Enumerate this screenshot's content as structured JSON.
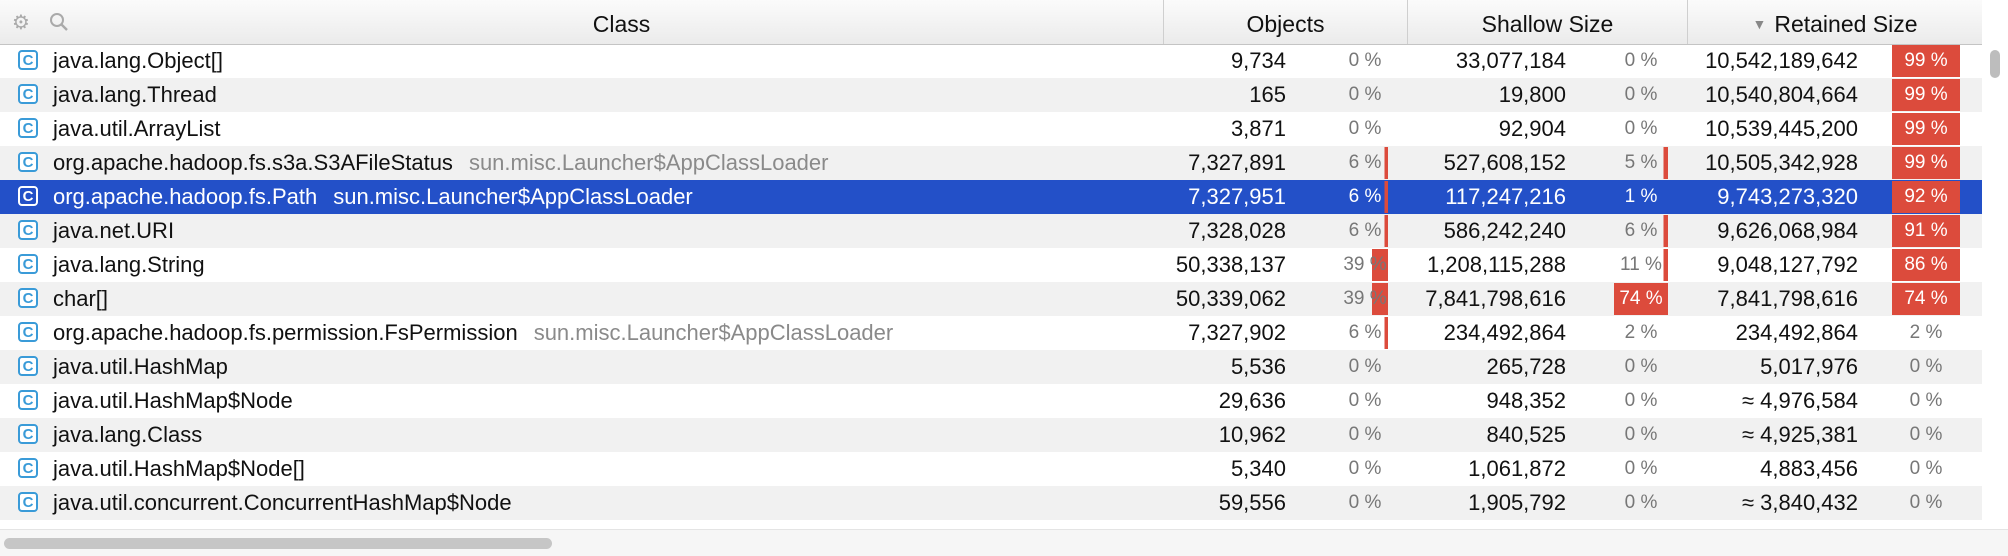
{
  "header": {
    "class": "Class",
    "objects": "Objects",
    "shallow": "Shallow Size",
    "retained": "Retained Size",
    "settings_icon": "gear-icon",
    "search_icon": "search-icon"
  },
  "rows": [
    {
      "name": "java.lang.Object[]",
      "loader": "",
      "objects": "9,734",
      "objects_pct": "0 %",
      "shallow": "33,077,184",
      "shallow_pct": "0 %",
      "retained": "10,542,189,642",
      "retained_pct": "99 %"
    },
    {
      "name": "java.lang.Thread",
      "loader": "",
      "objects": "165",
      "objects_pct": "0 %",
      "shallow": "19,800",
      "shallow_pct": "0 %",
      "retained": "10,540,804,664",
      "retained_pct": "99 %"
    },
    {
      "name": "java.util.ArrayList",
      "loader": "",
      "objects": "3,871",
      "objects_pct": "0 %",
      "shallow": "92,904",
      "shallow_pct": "0 %",
      "retained": "10,539,445,200",
      "retained_pct": "99 %"
    },
    {
      "name": "org.apache.hadoop.fs.s3a.S3AFileStatus",
      "loader": "sun.misc.Launcher$AppClassLoader",
      "objects": "7,327,891",
      "objects_pct": "6 %",
      "shallow": "527,608,152",
      "shallow_pct": "5 %",
      "retained": "10,505,342,928",
      "retained_pct": "99 %"
    },
    {
      "name": "org.apache.hadoop.fs.Path",
      "loader": "sun.misc.Launcher$AppClassLoader",
      "objects": "7,327,951",
      "objects_pct": "6 %",
      "shallow": "117,247,216",
      "shallow_pct": "1 %",
      "retained": "9,743,273,320",
      "retained_pct": "92 %"
    },
    {
      "name": "java.net.URI",
      "loader": "",
      "objects": "7,328,028",
      "objects_pct": "6 %",
      "shallow": "586,242,240",
      "shallow_pct": "6 %",
      "retained": "9,626,068,984",
      "retained_pct": "91 %"
    },
    {
      "name": "java.lang.String",
      "loader": "",
      "objects": "50,338,137",
      "objects_pct": "39 %",
      "shallow": "1,208,115,288",
      "shallow_pct": "11 %",
      "retained": "9,048,127,792",
      "retained_pct": "86 %"
    },
    {
      "name": "char[]",
      "loader": "",
      "objects": "50,339,062",
      "objects_pct": "39 %",
      "shallow": "7,841,798,616",
      "shallow_pct": "74 %",
      "retained": "7,841,798,616",
      "retained_pct": "74 %"
    },
    {
      "name": "org.apache.hadoop.fs.permission.FsPermission",
      "loader": "sun.misc.Launcher$AppClassLoader",
      "objects": "7,327,902",
      "objects_pct": "6 %",
      "shallow": "234,492,864",
      "shallow_pct": "2 %",
      "retained": "234,492,864",
      "retained_pct": "2 %"
    },
    {
      "name": "java.util.HashMap",
      "loader": "",
      "objects": "5,536",
      "objects_pct": "0 %",
      "shallow": "265,728",
      "shallow_pct": "0 %",
      "retained": "5,017,976",
      "retained_pct": "0 %"
    },
    {
      "name": "java.util.HashMap$Node",
      "loader": "",
      "objects": "29,636",
      "objects_pct": "0 %",
      "shallow": "948,352",
      "shallow_pct": "0 %",
      "retained": "≈ 4,976,584",
      "retained_pct": "0 %"
    },
    {
      "name": "java.lang.Class",
      "loader": "",
      "objects": "10,962",
      "objects_pct": "0 %",
      "shallow": "840,525",
      "shallow_pct": "0 %",
      "retained": "≈ 4,925,381",
      "retained_pct": "0 %"
    },
    {
      "name": "java.util.HashMap$Node[]",
      "loader": "",
      "objects": "5,340",
      "objects_pct": "0 %",
      "shallow": "1,061,872",
      "shallow_pct": "0 %",
      "retained": "4,883,456",
      "retained_pct": "0 %"
    },
    {
      "name": "java.util.concurrent.ConcurrentHashMap$Node",
      "loader": "",
      "objects": "59,556",
      "objects_pct": "0 %",
      "shallow": "1,905,792",
      "shallow_pct": "0 %",
      "retained": "≈ 3,840,432",
      "retained_pct": "0 %"
    }
  ],
  "row_icon": "class-c-icon",
  "selected_row": 4,
  "colors": {
    "selection": "#2350c8",
    "bar": "#dc4b3c",
    "class_icon": "#3a9bd8"
  }
}
